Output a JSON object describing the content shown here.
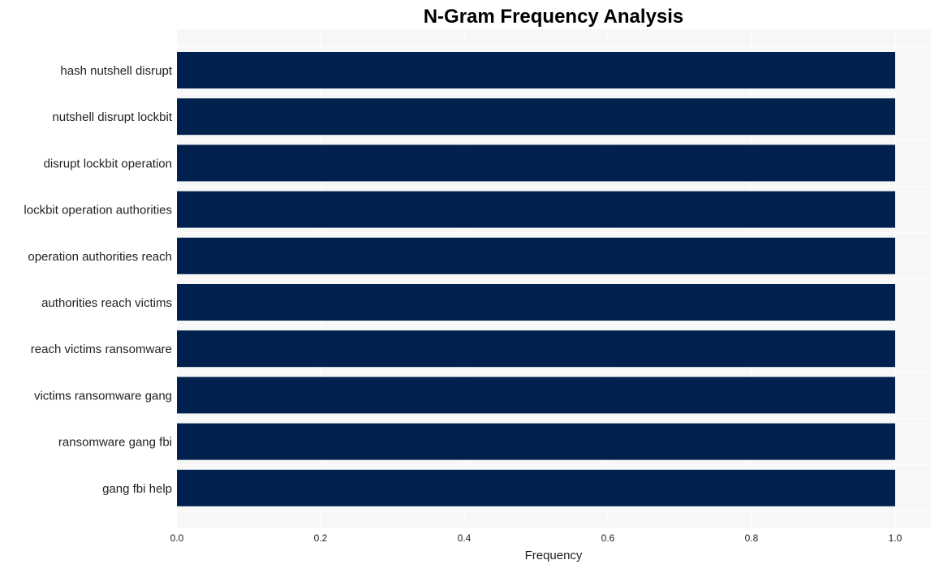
{
  "chart_data": {
    "type": "bar",
    "orientation": "horizontal",
    "title": "N-Gram Frequency Analysis",
    "xlabel": "Frequency",
    "ylabel": "",
    "categories": [
      "hash nutshell disrupt",
      "nutshell disrupt lockbit",
      "disrupt lockbit operation",
      "lockbit operation authorities",
      "operation authorities reach",
      "authorities reach victims",
      "reach victims ransomware",
      "victims ransomware gang",
      "ransomware gang fbi",
      "gang fbi help"
    ],
    "values": [
      1,
      1,
      1,
      1,
      1,
      1,
      1,
      1,
      1,
      1
    ],
    "xlim": [
      0,
      1.05
    ],
    "xticks": [
      0.0,
      0.2,
      0.4,
      0.6,
      0.8,
      1.0
    ],
    "xtick_labels": [
      "0.0",
      "0.2",
      "0.4",
      "0.6",
      "0.8",
      "1.0"
    ],
    "grid": true,
    "legend": "none",
    "colors": {
      "bar": "#00214d",
      "plot_bg": "#f7f7f7",
      "grid": "#ffffff"
    }
  }
}
